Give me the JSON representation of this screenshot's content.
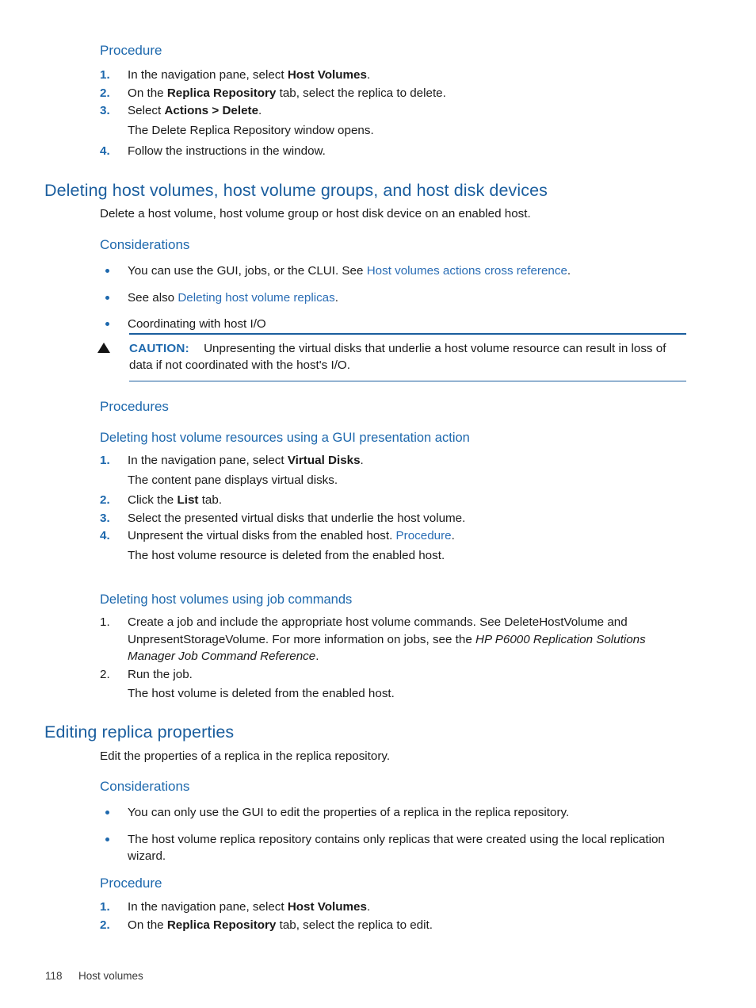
{
  "page": {
    "footer_page_number": "118",
    "footer_chapter": "Host volumes"
  },
  "colors": {
    "heading_blue": "#1b5e9e",
    "subheading_blue": "#1d68ad",
    "link_blue": "#2a6db5",
    "body_black": "#1a1a1a",
    "rule_blue": "#1b5e9e"
  },
  "sections": {
    "top_procedure": {
      "heading": "Procedure",
      "steps": [
        {
          "num": "1.",
          "pre": "In the navigation pane, select ",
          "bold": "Host Volumes",
          "post": "."
        },
        {
          "num": "2.",
          "pre": "On the ",
          "bold": "Replica Repository",
          "post": " tab, select the replica to delete."
        },
        {
          "num": "3.",
          "pre": "Select ",
          "bold": "Actions > Delete",
          "post": ".",
          "sub": "The Delete Replica Repository window opens."
        },
        {
          "num": "4.",
          "pre": "Follow the instructions in the window.",
          "bold": "",
          "post": ""
        }
      ]
    },
    "deleting_host_volumes": {
      "heading": "Deleting host volumes, host volume groups, and host disk devices",
      "intro": "Delete a host volume, host volume group or host disk device on an enabled host.",
      "considerations_heading": "Considerations",
      "considerations": [
        {
          "pre": "You can use the GUI, jobs, or the CLUI. See ",
          "link": "Host volumes actions cross reference",
          "post": "."
        },
        {
          "pre": "See also ",
          "link": "Deleting host volume replicas",
          "post": "."
        },
        {
          "pre": "Coordinating with host I/O",
          "link": "",
          "post": ""
        }
      ],
      "caution": {
        "label": "CAUTION:",
        "text": "Unpresenting the virtual disks that underlie a host volume resource can result in loss of data if not coordinated with the host's I/O."
      },
      "procedures_heading": "Procedures",
      "gui_procedure": {
        "heading": "Deleting host volume resources using a GUI presentation action",
        "steps": [
          {
            "num": "1.",
            "pre": "In the navigation pane, select ",
            "bold": "Virtual Disks",
            "post": ".",
            "sub": "The content pane displays virtual disks."
          },
          {
            "num": "2.",
            "pre": "Click the ",
            "bold": "List",
            "post": " tab."
          },
          {
            "num": "3.",
            "pre": "Select the presented virtual disks that underlie the host volume.",
            "bold": "",
            "post": ""
          },
          {
            "num": "4.",
            "pre": "Unpresent the virtual disks from the enabled host. ",
            "link": "Procedure",
            "post": ".",
            "sub": "The host volume resource is deleted from the enabled host."
          }
        ]
      },
      "job_procedure": {
        "heading": "Deleting host volumes using job commands",
        "steps": [
          {
            "num": "1.",
            "pre": "Create a job and include the appropriate host volume commands. See DeleteHostVolume and UnpresentStorageVolume. For more information on jobs, see the ",
            "italic": "HP P6000 Replication Solutions Manager Job Command Reference",
            "post": "."
          },
          {
            "num": "2.",
            "pre": "Run the job.",
            "italic": "",
            "post": "",
            "sub": "The host volume is deleted from the enabled host."
          }
        ]
      }
    },
    "editing_replica_properties": {
      "heading": "Editing replica properties",
      "intro": "Edit the properties of a replica in the replica repository.",
      "considerations_heading": "Considerations",
      "considerations": [
        {
          "text": "You can only use the GUI to edit the properties of a replica in the replica repository."
        },
        {
          "text": "The host volume replica repository contains only replicas that were created using the local replication wizard."
        }
      ],
      "procedure_heading": "Procedure",
      "steps": [
        {
          "num": "1.",
          "pre": "In the navigation pane, select ",
          "bold": "Host Volumes",
          "post": "."
        },
        {
          "num": "2.",
          "pre": "On the ",
          "bold": "Replica Repository",
          "post": " tab, select the replica to edit."
        }
      ]
    }
  }
}
